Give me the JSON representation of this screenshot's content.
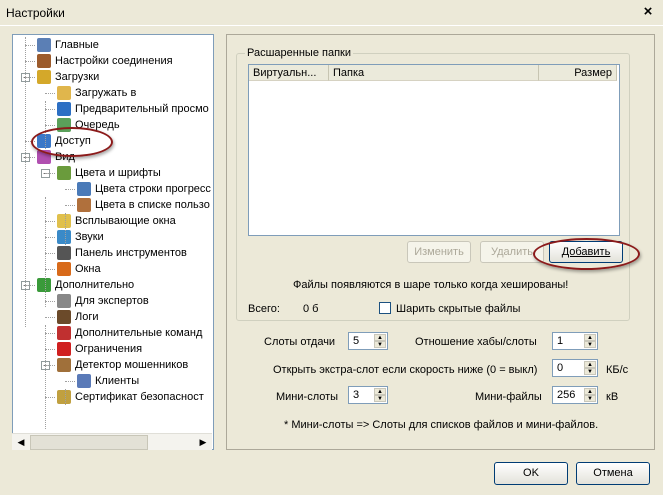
{
  "window": {
    "title": "Настройки",
    "close": "×"
  },
  "tree": [
    {
      "label": "Главные",
      "icon": "users-icon",
      "color": "#5b7fb5",
      "level": 0
    },
    {
      "label": "Настройки соединения",
      "icon": "network-icon",
      "color": "#9c5b2c",
      "level": 0
    },
    {
      "label": "Загрузки",
      "icon": "download-icon",
      "color": "#d4a82a",
      "level": 0,
      "expanded": true
    },
    {
      "label": "Загружать в",
      "icon": "folder-download-icon",
      "color": "#e0b64c",
      "level": 1
    },
    {
      "label": "Предварительный просмо",
      "icon": "preview-icon",
      "color": "#2c6fc4",
      "level": 1
    },
    {
      "label": "Очередь",
      "icon": "queue-icon",
      "color": "#5aa05a",
      "level": 1
    },
    {
      "label": "Доступ",
      "icon": "share-icon",
      "color": "#3a78c8",
      "level": 0,
      "selected": true
    },
    {
      "label": "Вид",
      "icon": "view-icon",
      "color": "#b04fb0",
      "level": 0,
      "expanded": true
    },
    {
      "label": "Цвета и шрифты",
      "icon": "colors-icon",
      "color": "#6a9b3c",
      "level": 1,
      "expanded": true
    },
    {
      "label": "Цвета строки прогресс",
      "icon": "progress-colors-icon",
      "color": "#4a7ab8",
      "level": 2
    },
    {
      "label": "Цвета в списке пользо",
      "icon": "user-colors-icon",
      "color": "#b0703c",
      "level": 2
    },
    {
      "label": "Всплывающие окна",
      "icon": "popup-icon",
      "color": "#e0c04c",
      "level": 1
    },
    {
      "label": "Звуки",
      "icon": "sound-icon",
      "color": "#3a8ac8",
      "level": 1
    },
    {
      "label": "Панель инструментов",
      "icon": "toolbar-icon",
      "color": "#555555",
      "level": 1
    },
    {
      "label": "Окна",
      "icon": "windows-icon",
      "color": "#d86a1a",
      "level": 1
    },
    {
      "label": "Дополнительно",
      "icon": "advanced-icon",
      "color": "#3a9a3a",
      "level": 0,
      "expanded": true
    },
    {
      "label": "Для экспертов",
      "icon": "expert-icon",
      "color": "#888888",
      "level": 1
    },
    {
      "label": "Логи",
      "icon": "logs-icon",
      "color": "#6b4a2a",
      "level": 1
    },
    {
      "label": "Дополнительные команд",
      "icon": "commands-icon",
      "color": "#c03030",
      "level": 1
    },
    {
      "label": "Ограничения",
      "icon": "limits-icon",
      "color": "#d02020",
      "level": 1
    },
    {
      "label": "Детектор мошенников",
      "icon": "detector-icon",
      "color": "#a0703a",
      "level": 1,
      "expanded": true
    },
    {
      "label": "Клиенты",
      "icon": "clients-icon",
      "color": "#5a7ab8",
      "level": 2
    },
    {
      "label": "Сертификат безопасност",
      "icon": "certificate-icon",
      "color": "#c0a040",
      "level": 1
    }
  ],
  "shared": {
    "group_label": "Расшаренные папки",
    "columns": [
      "Виртуальн...",
      "Папка",
      "Размер"
    ],
    "btn_edit": "Изменить",
    "btn_remove": "Удалить",
    "btn_add": "Добавить",
    "hint": "Файлы появляются в шаре только когда хешированы!",
    "total_label": "Всего:",
    "total_value": "0 б",
    "hidden_label": "Шарить скрытые файлы"
  },
  "settings": {
    "upload_slots_label": "Слоты отдачи",
    "upload_slots": "5",
    "hub_ratio_label": "Отношение хабы/слоты",
    "hub_ratio": "1",
    "extra_slot_label": "Открыть экстра-слот если скорость ниже (0 = выкл)",
    "extra_slot": "0",
    "extra_slot_unit": "КБ/с",
    "mini_slots_label": "Мини-слоты",
    "mini_slots": "3",
    "mini_files_label": "Мини-файлы",
    "mini_files": "256",
    "mini_files_unit": "кВ",
    "note": "* Мини-слоты => Слоты для списков файлов и мини-файлов."
  },
  "footer": {
    "ok": "OK",
    "cancel": "Отмена"
  }
}
